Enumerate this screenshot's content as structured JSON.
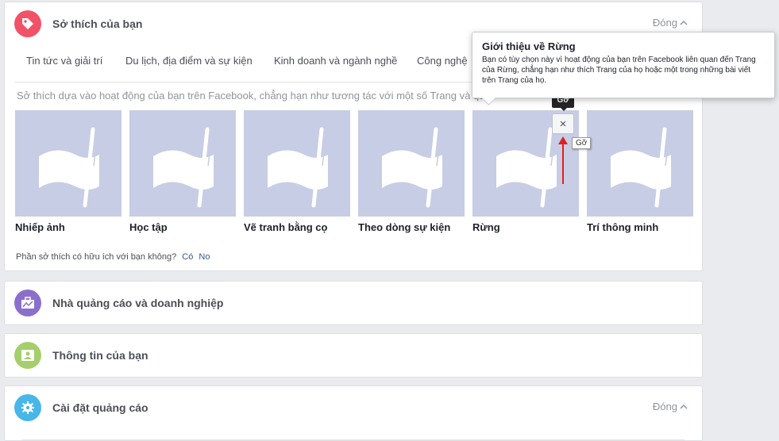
{
  "interests": {
    "title": "Sở thích của bạn",
    "toggle": "Đóng",
    "tabs": [
      "Tin tức và giải trí",
      "Du lịch, địa điểm và sự kiện",
      "Kinh doanh và ngành nghề",
      "Công nghệ"
    ],
    "description": "Sở thích dựa vào hoạt động của bạn trên Facebook, chẳng hạn như tương tác với một số Trang và quảng cáo.",
    "items": [
      "Nhiếp ảnh",
      "Học tập",
      "Vẽ tranh bằng cọ",
      "Theo dòng sự kiện",
      "Rừng",
      "Trí thông minh"
    ],
    "feedback_question": "Phần sở thích có hữu ích với bạn không?",
    "yes": "Có",
    "no": "No",
    "remove_symbol": "×",
    "remove_tooltip": "Gỡ",
    "remove_hint": "Gỡ",
    "accent_color": "#f25268"
  },
  "popover": {
    "title": "Giới thiệu về Rừng",
    "body": "Bạn có tùy chọn này vì hoạt động của bạn trên Facebook liên quan đến Trang của Rừng, chẳng hạn như thích Trang của họ hoặc một trong những bài viết trên Trang của họ."
  },
  "advertisers": {
    "title": "Nhà quảng cáo và doanh nghiệp",
    "accent_color": "#8b6fcd"
  },
  "your_info": {
    "title": "Thông tin của bạn",
    "accent_color": "#a4cf6c"
  },
  "ad_settings": {
    "title": "Cài đặt quảng cáo",
    "toggle": "Đóng",
    "accent_color": "#48b6e8"
  }
}
